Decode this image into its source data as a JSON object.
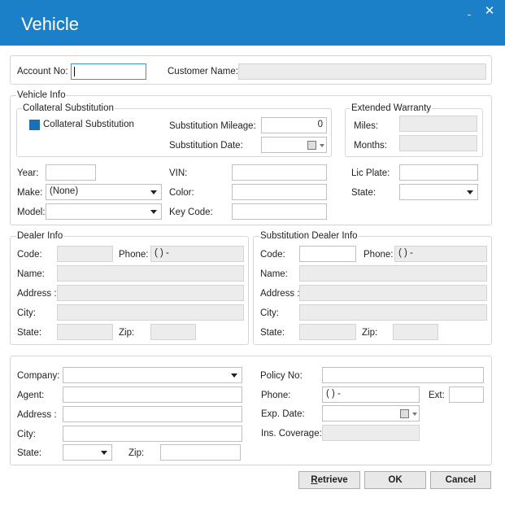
{
  "window": {
    "title": "Vehicle",
    "minimize_glyph": "ˍ",
    "close_glyph": "✕"
  },
  "account": {
    "account_no_label": "Account No:",
    "account_no_value": "",
    "customer_name_label": "Customer Name:",
    "customer_name_value": ""
  },
  "vehicle_info": {
    "legend": "Vehicle Info",
    "collateral": {
      "legend": "Collateral Substitution",
      "checkbox_label": "Collateral Substitution",
      "checked": true,
      "mileage_label": "Substitution Mileage:",
      "mileage_value": "0",
      "date_label": "Substitution Date:",
      "date_value": ""
    },
    "warranty": {
      "legend": "Extended Warranty",
      "miles_label": "Miles:",
      "months_label": "Months:"
    },
    "year_label": "Year:",
    "year_value": "",
    "make_label": "Make:",
    "make_value": "(None)",
    "model_label": "Model:",
    "model_value": "",
    "vin_label": "VIN:",
    "color_label": "Color:",
    "key_code_label": "Key Code:",
    "lic_plate_label": "Lic Plate:",
    "state_label": "State:",
    "state_value": ""
  },
  "dealer_info": {
    "legend": "Dealer Info",
    "code_label": "Code:",
    "phone_label": "Phone:",
    "phone_value": "(  )  -",
    "name_label": "Name:",
    "address_label": "Address :",
    "city_label": "City:",
    "state_label": "State:",
    "zip_label": "Zip:"
  },
  "substitution_dealer_info": {
    "legend": "Substitution Dealer Info",
    "code_label": "Code:",
    "phone_label": "Phone:",
    "phone_value": "(  )  -",
    "name_label": "Name:",
    "address_label": "Address :",
    "city_label": "City:",
    "state_label": "State:",
    "zip_label": "Zip:"
  },
  "insurance": {
    "company_label": "Company:",
    "agent_label": "Agent:",
    "address_label": "Address :",
    "city_label": "City:",
    "state_label": "State:",
    "zip_label": "Zip:",
    "policy_no_label": "Policy No:",
    "phone_label": "Phone:",
    "phone_value": "(  )  -",
    "ext_label": "Ext:",
    "exp_date_label": "Exp. Date:",
    "ins_coverage_label": "Ins. Coverage:"
  },
  "buttons": {
    "retrieve_underlined": "R",
    "retrieve_rest": "etrieve",
    "ok": "OK",
    "cancel": "Cancel"
  },
  "colors": {
    "titlebar": "#1b80c8",
    "checkbox": "#1b6fb5",
    "readonly_field": "#ececec"
  }
}
